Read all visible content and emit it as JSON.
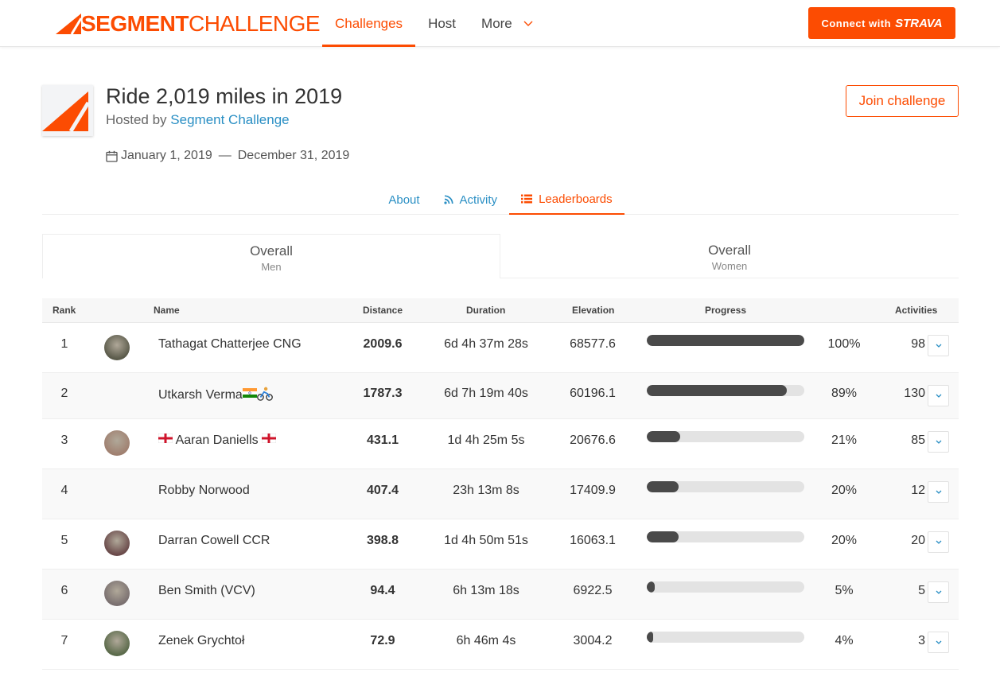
{
  "header": {
    "logo_bold": "SEGMENT",
    "logo_light": "CHALLENGE",
    "nav": [
      {
        "label": "Challenges"
      },
      {
        "label": "Host"
      },
      {
        "label": "More"
      }
    ],
    "connect_prefix": "Connect with",
    "connect_brand": "STRAVA"
  },
  "challenge": {
    "title": "Ride 2,019 miles in 2019",
    "hosted_prefix": "Hosted by",
    "host": "Segment Challenge",
    "start_date": "January 1, 2019",
    "date_sep": "—",
    "end_date": "December 31, 2019",
    "join_label": "Join challenge"
  },
  "tabs": [
    {
      "label": "About"
    },
    {
      "label": "Activity"
    },
    {
      "label": "Leaderboards"
    }
  ],
  "boards": [
    {
      "title": "Overall",
      "subtitle": "Men"
    },
    {
      "title": "Overall",
      "subtitle": "Women"
    }
  ],
  "table": {
    "headers": {
      "rank": "Rank",
      "name": "Name",
      "distance": "Distance",
      "duration": "Duration",
      "elevation": "Elevation",
      "progress": "Progress",
      "activities": "Activities"
    },
    "rows": [
      {
        "rank": "1",
        "name": "Tathagat Chatterjee CNG",
        "distance": "2009.6",
        "duration": "6d 4h 37m 28s",
        "elevation": "68577.6",
        "progress": 1.0,
        "percent": "100%",
        "activities": "98",
        "avatar": "#5a5a4a"
      },
      {
        "rank": "2",
        "name": "Utkarsh Verma",
        "distance": "1787.3",
        "duration": "6d 7h 19m 40s",
        "elevation": "60196.1",
        "progress": 0.89,
        "percent": "89%",
        "activities": "130",
        "avatar": ""
      },
      {
        "rank": "3",
        "name": "Aaran Daniells",
        "distance": "431.1",
        "duration": "1d 4h 25m 5s",
        "elevation": "20676.6",
        "progress": 0.21,
        "percent": "21%",
        "activities": "85",
        "avatar": "#a08070"
      },
      {
        "rank": "4",
        "name": "Robby Norwood",
        "distance": "407.4",
        "duration": "23h 13m 8s",
        "elevation": "17409.9",
        "progress": 0.2,
        "percent": "20%",
        "activities": "12",
        "avatar": ""
      },
      {
        "rank": "5",
        "name": "Darran Cowell CCR",
        "distance": "398.8",
        "duration": "1d 4h 50m 51s",
        "elevation": "16063.1",
        "progress": 0.2,
        "percent": "20%",
        "activities": "20",
        "avatar": "#6a4a4a"
      },
      {
        "rank": "6",
        "name": "Ben Smith (VCV)",
        "distance": "94.4",
        "duration": "6h 13m 18s",
        "elevation": "6922.5",
        "progress": 0.05,
        "percent": "5%",
        "activities": "5",
        "avatar": "#7a7070"
      },
      {
        "rank": "7",
        "name": "Zenek Grychtoł",
        "distance": "72.9",
        "duration": "6h 46m 4s",
        "elevation": "3004.2",
        "progress": 0.04,
        "percent": "4%",
        "activities": "3",
        "avatar": "#5a6a4a"
      }
    ]
  },
  "colors": {
    "accent": "#fc4c02",
    "link": "#2a8fc4",
    "bar_fill": "#4a4a4a",
    "bar_track": "#e3e3e3"
  }
}
